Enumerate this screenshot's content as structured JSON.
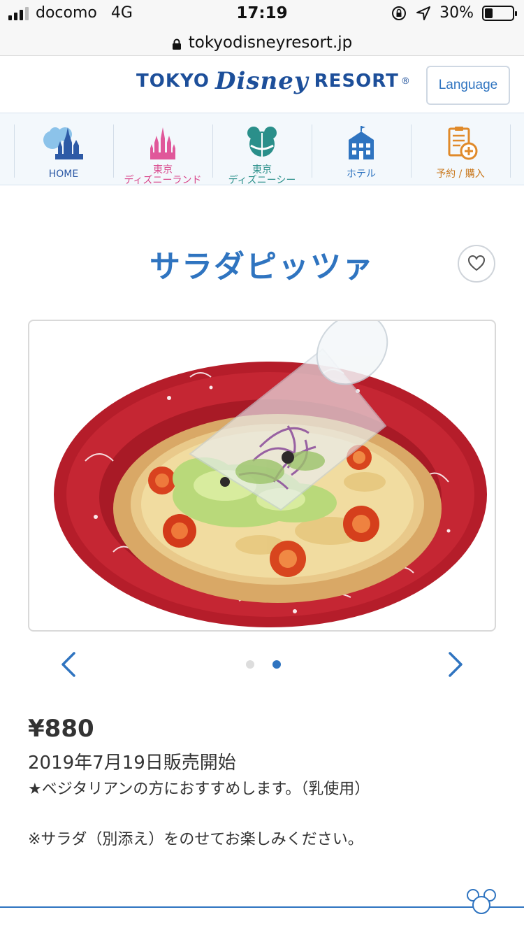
{
  "status_bar": {
    "carrier": "docomo",
    "network": "4G",
    "time": "17:19",
    "battery": "30%",
    "battery_level": 0.3
  },
  "url_bar": {
    "domain": "tokyodisneyresort.jp"
  },
  "header": {
    "logo_left": "TOKYO",
    "logo_script": "Disney",
    "logo_right": "RESORT",
    "logo_reg": "®",
    "language_button": "Language"
  },
  "nav": {
    "items": [
      {
        "line1": "HOME",
        "line2": "",
        "color": "#2d5aa6",
        "icon": "castle-icon"
      },
      {
        "line1": "東京",
        "line2": "ディズニーランド",
        "color": "#d8468b",
        "icon": "pink-castle-icon"
      },
      {
        "line1": "東京",
        "line2": "ディズニーシー",
        "color": "#2a8f8a",
        "icon": "globe-icon"
      },
      {
        "line1": "ホテル",
        "line2": "",
        "color": "#2f74c0",
        "icon": "hotel-icon"
      },
      {
        "line1": "予約 / 購入",
        "line2": "",
        "color": "#c9781d",
        "icon": "reservation-icon"
      }
    ]
  },
  "product": {
    "title": "サラダピッツァ",
    "price": "¥880",
    "release_date": "2019年7月19日販売開始",
    "note": "★ベジタリアンの方におすすめします。（乳使用）",
    "note2": "※サラダ（別添え）をのせてお楽しみください。"
  },
  "carousel": {
    "total": 2,
    "active_index": 1
  },
  "colors": {
    "accent": "#2f74c0",
    "plate_red": "#c2202c"
  }
}
